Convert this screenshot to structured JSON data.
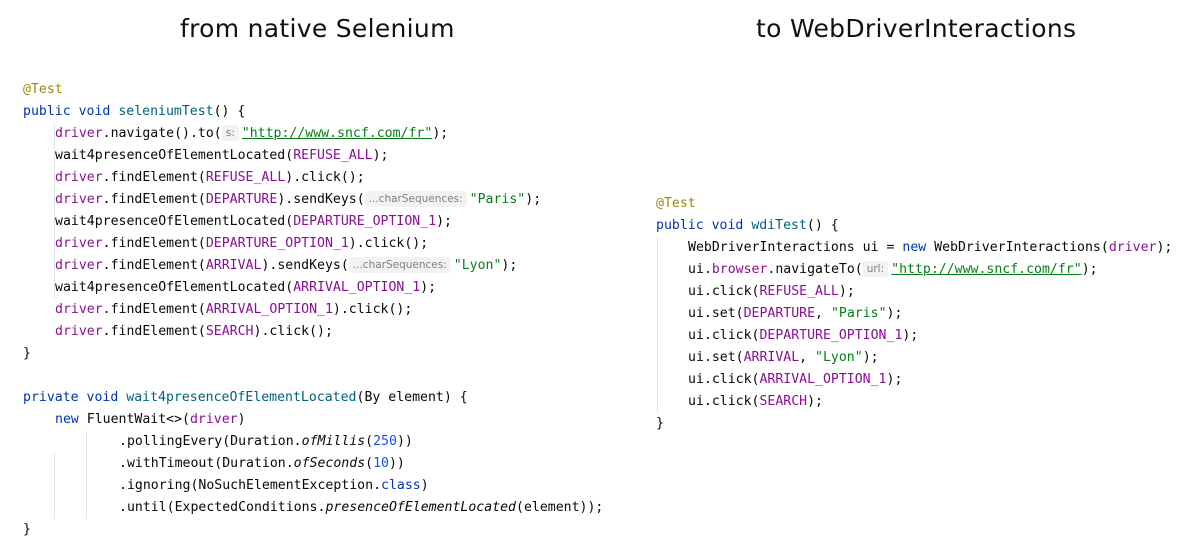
{
  "headings": {
    "left": "from native Selenium",
    "right": "to WebDriverInteractions"
  },
  "left_code": {
    "annotation": "@Test",
    "kw_public": "public",
    "kw_void": "void",
    "method_name": "seleniumTest",
    "sig_tail": "() {",
    "driver": "driver",
    "navigate_to": ".navigate().to(",
    "hint_s": "s:",
    "url": "\"http://www.sncf.com/fr\"",
    "close_semi": ");",
    "wait_call": "wait4presenceOfElementLocated(",
    "refuse_all": "REFUSE_ALL",
    "find_element": ".findElement(",
    "click_tail": ").click();",
    "departure": "DEPARTURE",
    "send_keys": ").sendKeys(",
    "hint_chars": "...charSequences:",
    "paris": "\"Paris\"",
    "departure_option_1": "DEPARTURE_OPTION_1",
    "arrival": "ARRIVAL",
    "lyon": "\"Lyon\"",
    "arrival_option_1": "ARRIVAL_OPTION_1",
    "search": "SEARCH",
    "close_brace": "}",
    "kw_private": "private",
    "wait_method_name": "wait4presenceOfElementLocated",
    "wait_params": "(By element) {",
    "kw_new": "new",
    "fluent_wait": " FluentWait<>(",
    "fluent_close": ")",
    "polling_every": ".pollingEvery(Duration.",
    "of_millis": "ofMillis",
    "num_250": "250",
    "double_close": "))",
    "with_timeout": ".withTimeout(Duration.",
    "of_seconds": "ofSeconds",
    "num_10": "10",
    "ignoring": ".ignoring(NoSuchElementException.",
    "kw_class": "class",
    "until": ".until(ExpectedConditions.",
    "presence_of": "presenceOfElementLocated",
    "until_tail": "(element));"
  },
  "right_code": {
    "annotation": "@Test",
    "kw_public": "public",
    "kw_void": "void",
    "method_name": "wdiTest",
    "sig_tail": "() {",
    "decl_type": "WebDriverInteractions ui = ",
    "kw_new": "new",
    "ctor_call": " WebDriverInteractions(",
    "driver": "driver",
    "close_semi": ");",
    "ui": "ui",
    "dot": ".",
    "browser": "browser",
    "navigate_to": ".navigateTo(",
    "hint_url": "url:",
    "url": "\"http://www.sncf.com/fr\"",
    "click_open": "ui.click(",
    "set_open": "ui.set(",
    "refuse_all": "REFUSE_ALL",
    "departure": "DEPARTURE",
    "comma": ", ",
    "paris": "\"Paris\"",
    "departure_option_1": "DEPARTURE_OPTION_1",
    "arrival": "ARRIVAL",
    "lyon": "\"Lyon\"",
    "arrival_option_1": "ARRIVAL_OPTION_1",
    "search": "SEARCH",
    "close_brace": "}"
  }
}
